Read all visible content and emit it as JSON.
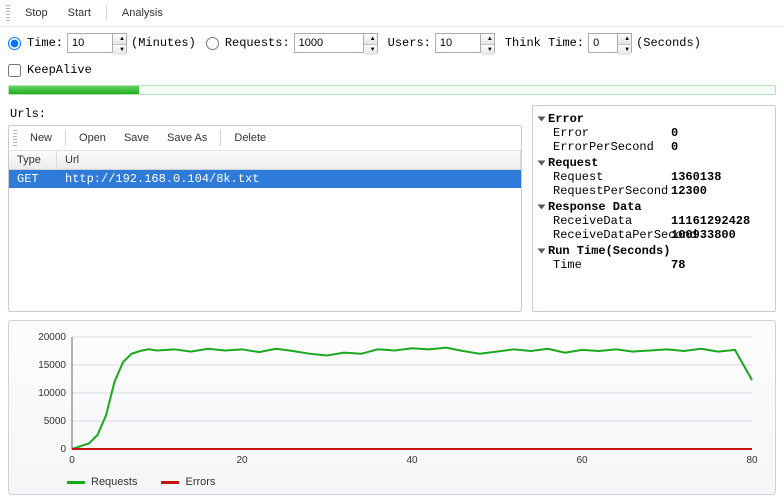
{
  "toolbar": {
    "stop": "Stop",
    "start": "Start",
    "analysis": "Analysis"
  },
  "params": {
    "time_label": "Time:",
    "time_value": "10",
    "time_unit": "(Minutes)",
    "requests_label": "Requests:",
    "requests_value": "1000",
    "users_label": "Users:",
    "users_value": "10",
    "thinktime_label": "Think Time:",
    "thinktime_value": "0",
    "thinktime_unit": "(Seconds)",
    "keepalive_label": "KeepAlive",
    "radio_selected": "time"
  },
  "progress_percent": 17,
  "urls": {
    "title": "Urls:",
    "buttons": {
      "new": "New",
      "open": "Open",
      "save": "Save",
      "saveas": "Save As",
      "delete": "Delete"
    },
    "headers": {
      "type": "Type",
      "url": "Url"
    },
    "rows": [
      {
        "type": "GET",
        "url": "http://192.168.0.104/8k.txt"
      }
    ]
  },
  "stats": {
    "sections": [
      {
        "title": "Error",
        "rows": [
          {
            "k": "Error",
            "v": "0"
          },
          {
            "k": "ErrorPerSecond",
            "v": "0"
          }
        ]
      },
      {
        "title": "Request",
        "rows": [
          {
            "k": "Request",
            "v": "1360138"
          },
          {
            "k": "RequestPerSecond",
            "v": "12300"
          }
        ]
      },
      {
        "title": "Response Data",
        "rows": [
          {
            "k": "ReceiveData",
            "v": "11161292428"
          },
          {
            "k": "ReceiveDataPerSecond",
            "v": "100933800"
          }
        ]
      },
      {
        "title": "Run Time(Seconds)",
        "rows": [
          {
            "k": "Time",
            "v": "78"
          }
        ]
      }
    ]
  },
  "chart_data": {
    "type": "line",
    "xlabel": "",
    "ylabel": "",
    "xlim": [
      0,
      80
    ],
    "ylim": [
      0,
      20000
    ],
    "xticks": [
      0,
      20,
      40,
      60,
      80
    ],
    "yticks": [
      0,
      5000,
      10000,
      15000,
      20000
    ],
    "x": [
      0,
      1,
      2,
      3,
      4,
      5,
      6,
      7,
      8,
      9,
      10,
      12,
      14,
      16,
      18,
      20,
      22,
      24,
      26,
      28,
      30,
      32,
      34,
      36,
      38,
      40,
      42,
      44,
      46,
      48,
      50,
      52,
      54,
      56,
      58,
      60,
      62,
      64,
      66,
      68,
      70,
      72,
      74,
      76,
      78,
      80
    ],
    "series": [
      {
        "name": "Requests",
        "color": "#19a81e",
        "values": [
          0,
          500,
          1000,
          2500,
          6000,
          12000,
          15500,
          17000,
          17500,
          17800,
          17600,
          17800,
          17400,
          17900,
          17600,
          17800,
          17300,
          17900,
          17500,
          17000,
          16700,
          17200,
          17000,
          17800,
          17600,
          18000,
          17800,
          18100,
          17500,
          17000,
          17400,
          17800,
          17500,
          17900,
          17200,
          17700,
          17500,
          17800,
          17400,
          17600,
          17800,
          17500,
          17900,
          17400,
          17700,
          12300
        ]
      },
      {
        "name": "Errors",
        "color": "#c91414",
        "values": [
          0,
          0,
          0,
          0,
          0,
          0,
          0,
          0,
          0,
          0,
          0,
          0,
          0,
          0,
          0,
          0,
          0,
          0,
          0,
          0,
          0,
          0,
          0,
          0,
          0,
          0,
          0,
          0,
          0,
          0,
          0,
          0,
          0,
          0,
          0,
          0,
          0,
          0,
          0,
          0,
          0,
          0,
          0,
          0,
          0,
          0
        ]
      }
    ]
  },
  "legend": {
    "requests": "Requests",
    "errors": "Errors"
  }
}
